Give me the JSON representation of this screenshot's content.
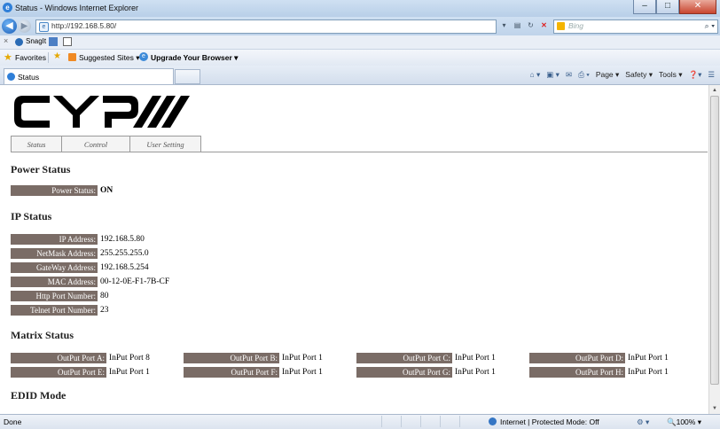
{
  "window": {
    "title": "Status - Windows Internet Explorer"
  },
  "address": {
    "url": "http://192.168.5.80/"
  },
  "search": {
    "placeholder": "Bing"
  },
  "snagit": {
    "label": "SnagIt"
  },
  "favorites": {
    "label": "Favorites",
    "suggested_sites": "Suggested Sites ▾",
    "upgrade": "Upgrade Your Browser ▾"
  },
  "tab": {
    "label": "Status"
  },
  "commands": {
    "page": "Page ▾",
    "safety": "Safety ▾",
    "tools": "Tools ▾"
  },
  "page": {
    "nav_tabs": [
      "Status",
      "Control",
      "User Setting"
    ],
    "power": {
      "heading": "Power Status",
      "label": "Power Status:",
      "value": "ON"
    },
    "ip": {
      "heading": "IP Status",
      "rows": [
        {
          "label": "IP Address:",
          "value": "192.168.5.80"
        },
        {
          "label": "NetMask Address:",
          "value": "255.255.255.0"
        },
        {
          "label": "GateWay Address:",
          "value": "192.168.5.254"
        },
        {
          "label": "MAC Address:",
          "value": "00-12-0E-F1-7B-CF"
        },
        {
          "label": "Http Port Number:",
          "value": "80"
        },
        {
          "label": "Telnet Port Number:",
          "value": "23"
        }
      ]
    },
    "matrix": {
      "heading": "Matrix Status",
      "ports": [
        {
          "label": "OutPut Port A:",
          "value": "InPut Port 8"
        },
        {
          "label": "OutPut Port B:",
          "value": "InPut Port 1"
        },
        {
          "label": "OutPut Port C:",
          "value": "InPut Port 1"
        },
        {
          "label": "OutPut Port D:",
          "value": "InPut Port 1"
        },
        {
          "label": "OutPut Port E:",
          "value": "InPut Port 1"
        },
        {
          "label": "OutPut Port F:",
          "value": "InPut Port 1"
        },
        {
          "label": "OutPut Port G:",
          "value": "InPut Port 1"
        },
        {
          "label": "OutPut Port H:",
          "value": "InPut Port 1"
        }
      ]
    },
    "edid": {
      "heading": "EDID Mode"
    }
  },
  "status": {
    "left": "Done",
    "zone": "Internet | Protected Mode: Off",
    "zoom": "100%"
  }
}
